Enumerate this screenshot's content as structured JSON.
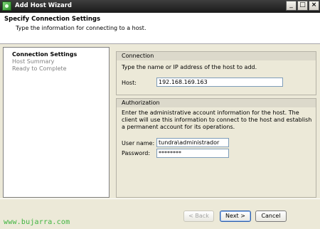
{
  "window": {
    "title": "Add Host Wizard",
    "controls": [
      "_",
      "□",
      "×"
    ]
  },
  "header": {
    "title": "Specify Connection Settings",
    "subtitle": "Type the information for connecting to a host."
  },
  "steps": [
    {
      "label": "Connection Settings",
      "state": "active"
    },
    {
      "label": "Host Summary",
      "state": "inactive"
    },
    {
      "label": "Ready to Complete",
      "state": "inactive"
    }
  ],
  "connection": {
    "legend": "Connection",
    "description": "Type the name or IP address of the host to add.",
    "host_label": "Host:",
    "host_value": "192.168.169.163"
  },
  "authorization": {
    "legend": "Authorization",
    "description": "Enter the administrative account information for the host. The client will use this information to connect to the host and establish a permanent account for its operations.",
    "username_label": "User name:",
    "username_value": "tundra\\administrador",
    "password_label": "Password:",
    "password_value": "********"
  },
  "buttons": {
    "back": "< Back",
    "next": "Next >",
    "cancel": "Cancel"
  },
  "watermark": "www.bujarra.com",
  "colors": {
    "titlebar": "#2a2a2a",
    "dialog_bg": "#ece9d8",
    "watermark": "#3fb43f"
  }
}
